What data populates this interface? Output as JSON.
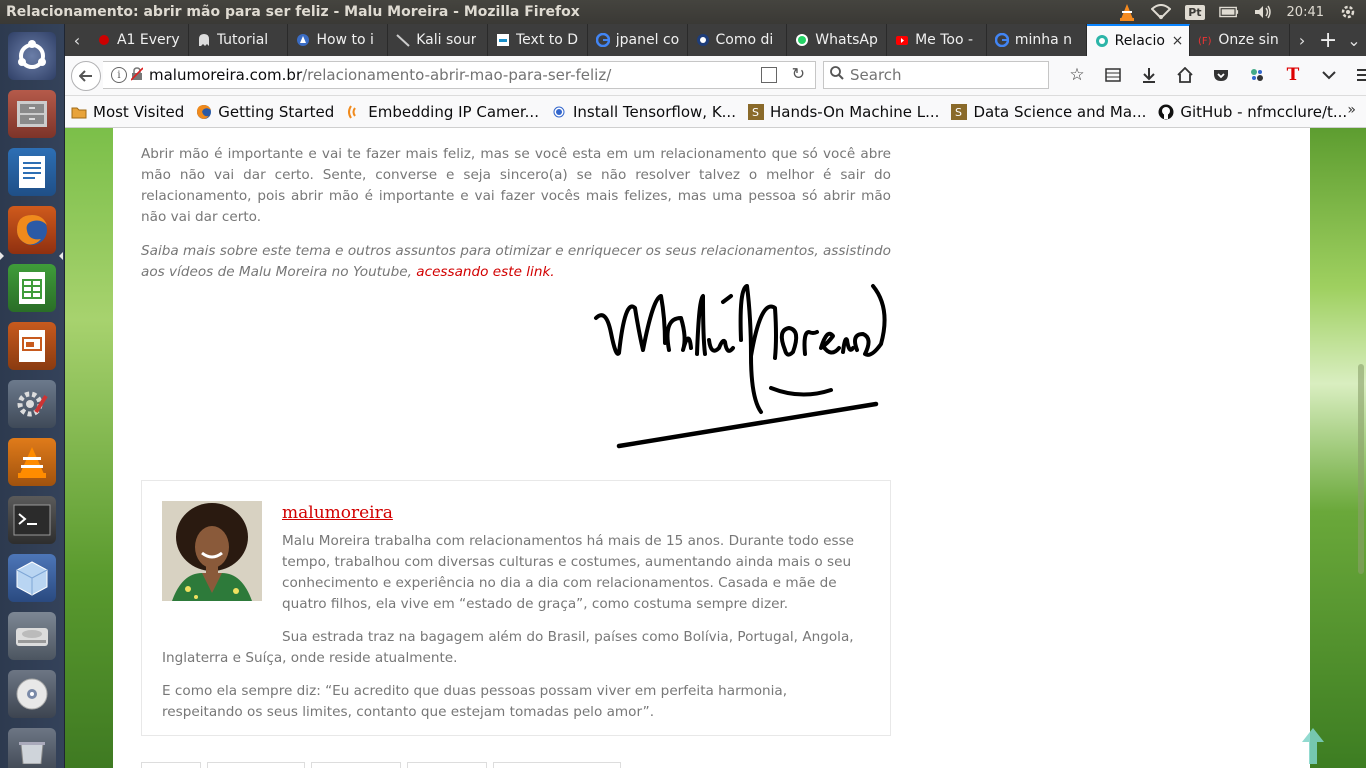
{
  "system": {
    "window_title": "Relacionamento: abrir mão para ser feliz - Malu Moreira - Mozilla Firefox",
    "keyboard_layout": "Pt",
    "clock": "20:41"
  },
  "launcher": {
    "items": [
      "ubuntu-dash",
      "files",
      "writer",
      "firefox",
      "calc",
      "impress",
      "system-settings",
      "vlc",
      "terminal",
      "virtualbox",
      "disk",
      "dvd",
      "trash"
    ]
  },
  "tabs": [
    {
      "label": "A1 Every",
      "icon": "red-icon"
    },
    {
      "label": "Tutorial",
      "icon": "ghost-icon"
    },
    {
      "label": "How to i",
      "icon": "globe-icon"
    },
    {
      "label": "Kali sour",
      "icon": "kali-icon"
    },
    {
      "label": "Text to D",
      "icon": "doc-icon"
    },
    {
      "label": "jpanel co",
      "icon": "google-icon"
    },
    {
      "label": "Como di",
      "icon": "blue-icon"
    },
    {
      "label": "WhatsAp",
      "icon": "whatsapp-icon"
    },
    {
      "label": "Me Too -",
      "icon": "youtube-icon"
    },
    {
      "label": "minha n",
      "icon": "google-icon"
    },
    {
      "label": "Relacio",
      "icon": "site-icon",
      "active": true
    },
    {
      "label": "Onze sin",
      "icon": "f-icon"
    }
  ],
  "navbar": {
    "url_host": "malumoreira.com.br",
    "url_path": "/relacionamento-abrir-mao-para-ser-feliz/",
    "search_placeholder": "Search"
  },
  "bookmarks": [
    {
      "label": "Most Visited",
      "icon": "folder-icon"
    },
    {
      "label": "Getting Started",
      "icon": "firefox-icon"
    },
    {
      "label": "Embedding IP Camer...",
      "icon": "wifi-icon"
    },
    {
      "label": "Install Tensorflow, K...",
      "icon": "dot-icon"
    },
    {
      "label": "Hands-On Machine L...",
      "icon": "s-icon"
    },
    {
      "label": "Data Science and Ma...",
      "icon": "s-icon"
    },
    {
      "label": "GitHub - nfmcclure/t...",
      "icon": "github-icon"
    }
  ],
  "article": {
    "paragraph1": "Abrir mão é importante e vai te fazer mais feliz, mas se você esta em um relacionamento que só você abre mão não vai dar certo. Sente, converse e seja sincero(a) se não resolver talvez o melhor é sair do relacionamento, pois abrir mão é importante e vai fazer vocês mais felizes, mas uma pessoa só abrir mão não vai dar certo.",
    "paragraph2_text": "Saiba mais sobre este tema e outros assuntos para otimizar e enriquecer os seus relacionamentos, assistindo aos vídeos de Malu Moreira no Youtube, ",
    "paragraph2_link": "acessando este link."
  },
  "signature_text": "Malu Moreira",
  "author": {
    "name": "malumoreira",
    "bio1": "Malu Moreira trabalha com relacionamentos há mais de 15 anos. Durante todo esse tempo, trabalhou com diversas culturas e costumes, aumentando ainda mais o seu conhecimento e experiência no dia a dia com relacionamentos. Casada e mãe de quatro filhos, ela vive em “estado de graça”, como costuma sempre dizer.",
    "bio2": "Sua estrada traz na bagagem além do Brasil, países como Bolívia, Portugal, Angola, Inglaterra e Suíça, onde reside atualmente.",
    "bio3": "E como ela sempre diz: “Eu acredito que duas pessoas possam viver em perfeita harmonia, respeitando os seus limites, contanto que estejam tomadas pelo amor”."
  },
  "colors": {
    "accent": "#d20000",
    "tab_active_line": "#0a84ff"
  }
}
